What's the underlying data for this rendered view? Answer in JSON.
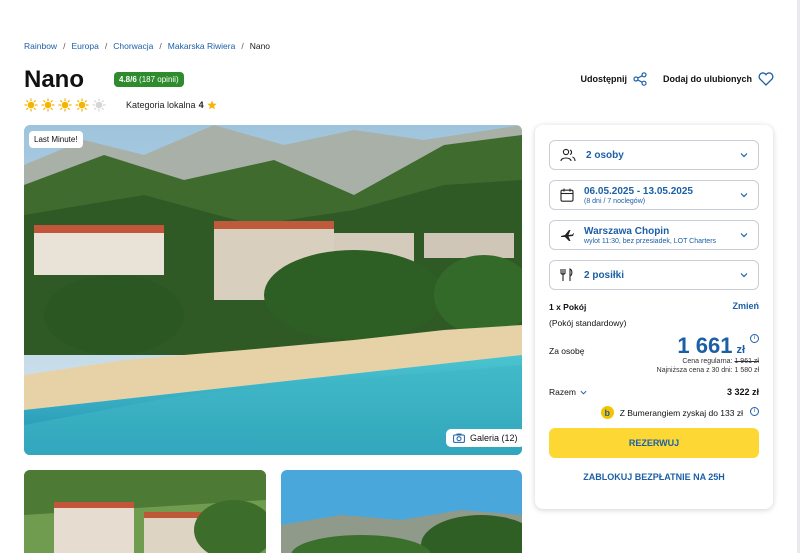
{
  "breadcrumb": [
    "Rainbow",
    "Europa",
    "Chorwacja",
    "Makarska Riwiera",
    "Nano"
  ],
  "breadcrumb_sep": "/",
  "hotel": {
    "name": "Nano",
    "rating": "4.8/6",
    "reviews": "(187 opinii)",
    "suns_filled": 4,
    "suns_total": 5,
    "category_label": "Kategoria lokalna",
    "category_value": "4"
  },
  "actions": {
    "share": "Udostępnij",
    "favorite": "Dodaj do ulubionych"
  },
  "gallery": {
    "badge": "Last Minute!",
    "button": "Galeria (12)"
  },
  "booking": {
    "persons": "2 osoby",
    "dates": "06.05.2025 - 13.05.2025",
    "dates_sub": "(8 dni / 7 noclegów)",
    "airport": "Warszawa Chopin",
    "airport_sub": "wylot 11:30, bez przesiadek, LOT Charters",
    "meals": "2 posiłki",
    "room_label": "1 x Pokój",
    "room_change": "Zmień",
    "room_type": "(Pokój standardowy)",
    "per_person_label": "Za osobę",
    "price": "1 661",
    "currency": "zł",
    "regular_label": "Cena regularna:",
    "regular_value": "1 961 zł",
    "lowest": "Najniższa cena z 30 dni: 1 580 zł",
    "total_label": "Razem",
    "total_value": "3 322 zł",
    "bumerang": "Z Bumerangiem zyskaj do 133 zł",
    "reserve": "REZERWUJ",
    "block": "ZABLOKUJ BEZPŁATNIE NA 25H"
  },
  "colors": {
    "accent": "#1b5fa6",
    "rating_green": "#2e8b2e",
    "cta_yellow": "#fdd835"
  }
}
